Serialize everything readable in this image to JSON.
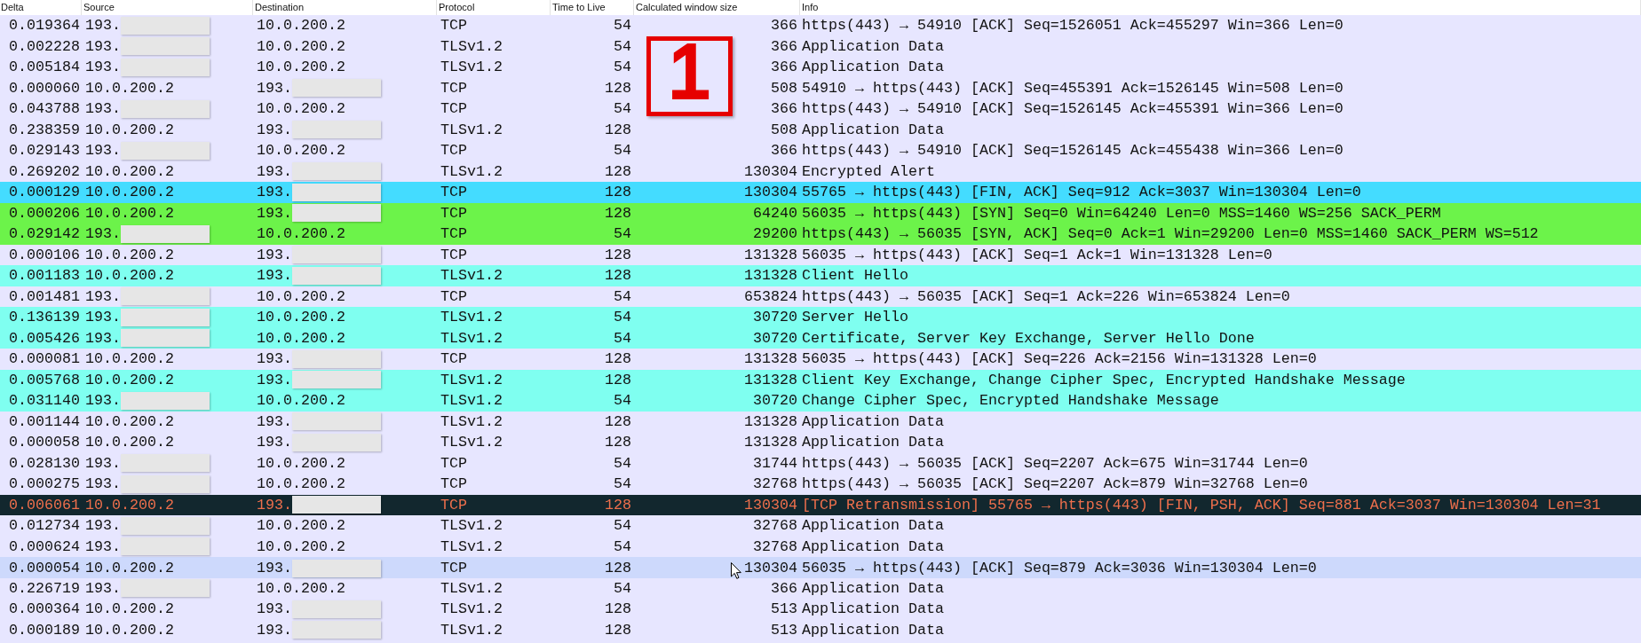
{
  "columns": [
    "Delta",
    "Source",
    "Destination",
    "Protocol",
    "Time to Live",
    "Calculated window size",
    "Info"
  ],
  "rows": [
    {
      "delta": "0.019364",
      "source": "193.",
      "source_redacted": true,
      "destination": "10.0.200.2",
      "destination_redacted": false,
      "protocol": "TCP",
      "ttl": "54",
      "window_size": "366",
      "info": "https(443) → 54910 [ACK] Seq=1526051 Ack=455297 Win=366 Len=0",
      "color": "#e7e6ff",
      "kind": "normal",
      "hovered": false
    },
    {
      "delta": "0.002228",
      "source": "193.",
      "source_redacted": true,
      "destination": "10.0.200.2",
      "destination_redacted": false,
      "protocol": "TLSv1.2",
      "ttl": "54",
      "window_size": "366",
      "info": "Application Data",
      "color": "#e7e6ff",
      "kind": "normal",
      "hovered": false
    },
    {
      "delta": "0.005184",
      "source": "193.",
      "source_redacted": true,
      "destination": "10.0.200.2",
      "destination_redacted": false,
      "protocol": "TLSv1.2",
      "ttl": "54",
      "window_size": "366",
      "info": "Application Data",
      "color": "#e7e6ff",
      "kind": "normal",
      "hovered": false
    },
    {
      "delta": "0.000060",
      "source": "10.0.200.2",
      "source_redacted": false,
      "destination": "193.",
      "destination_redacted": true,
      "protocol": "TCP",
      "ttl": "128",
      "window_size": "508",
      "info": "54910 → https(443) [ACK] Seq=455391 Ack=1526145 Win=508 Len=0",
      "color": "#e7e6ff",
      "kind": "normal",
      "hovered": false
    },
    {
      "delta": "0.043788",
      "source": "193.",
      "source_redacted": true,
      "destination": "10.0.200.2",
      "destination_redacted": false,
      "protocol": "TCP",
      "ttl": "54",
      "window_size": "366",
      "info": "https(443) → 54910 [ACK] Seq=1526145 Ack=455391 Win=366 Len=0",
      "color": "#e7e6ff",
      "kind": "normal",
      "hovered": false
    },
    {
      "delta": "0.238359",
      "source": "10.0.200.2",
      "source_redacted": false,
      "destination": "193.",
      "destination_redacted": true,
      "protocol": "TLSv1.2",
      "ttl": "128",
      "window_size": "508",
      "info": "Application Data",
      "color": "#e7e6ff",
      "kind": "normal",
      "hovered": false
    },
    {
      "delta": "0.029143",
      "source": "193.",
      "source_redacted": true,
      "destination": "10.0.200.2",
      "destination_redacted": false,
      "protocol": "TCP",
      "ttl": "54",
      "window_size": "366",
      "info": "https(443) → 54910 [ACK] Seq=1526145 Ack=455438 Win=366 Len=0",
      "color": "#e7e6ff",
      "kind": "normal",
      "hovered": false
    },
    {
      "delta": "0.269202",
      "source": "10.0.200.2",
      "source_redacted": false,
      "destination": "193.",
      "destination_redacted": true,
      "protocol": "TLSv1.2",
      "ttl": "128",
      "window_size": "130304",
      "info": "Encrypted Alert",
      "color": "#e7e6ff",
      "kind": "normal",
      "hovered": false
    },
    {
      "delta": "0.000129",
      "source": "10.0.200.2",
      "source_redacted": false,
      "destination": "193.",
      "destination_redacted": true,
      "protocol": "TCP",
      "ttl": "128",
      "window_size": "130304",
      "info": "55765 → https(443) [FIN, ACK] Seq=912 Ack=3037 Win=130304 Len=0",
      "color": "#44dcff",
      "kind": "normal",
      "hovered": false
    },
    {
      "delta": "0.000206",
      "source": "10.0.200.2",
      "source_redacted": false,
      "destination": "193.",
      "destination_redacted": true,
      "protocol": "TCP",
      "ttl": "128",
      "window_size": "64240",
      "info": "56035 → https(443) [SYN] Seq=0 Win=64240 Len=0 MSS=1460 WS=256 SACK_PERM",
      "color": "#6cf34a",
      "kind": "normal",
      "hovered": false
    },
    {
      "delta": "0.029142",
      "source": "193.",
      "source_redacted": true,
      "destination": "10.0.200.2",
      "destination_redacted": false,
      "protocol": "TCP",
      "ttl": "54",
      "window_size": "29200",
      "info": "https(443) → 56035 [SYN, ACK] Seq=0 Ack=1 Win=29200 Len=0 MSS=1460 SACK_PERM WS=512",
      "color": "#6cf34a",
      "kind": "normal",
      "hovered": false
    },
    {
      "delta": "0.000106",
      "source": "10.0.200.2",
      "source_redacted": false,
      "destination": "193.",
      "destination_redacted": true,
      "protocol": "TCP",
      "ttl": "128",
      "window_size": "131328",
      "info": "56035 → https(443) [ACK] Seq=1 Ack=1 Win=131328 Len=0",
      "color": "#e7e6ff",
      "kind": "normal",
      "hovered": false
    },
    {
      "delta": "0.001183",
      "source": "10.0.200.2",
      "source_redacted": false,
      "destination": "193.",
      "destination_redacted": true,
      "protocol": "TLSv1.2",
      "ttl": "128",
      "window_size": "131328",
      "info": "Client Hello",
      "color": "#7ffff0",
      "kind": "normal",
      "hovered": false
    },
    {
      "delta": "0.001481",
      "source": "193.",
      "source_redacted": true,
      "destination": "10.0.200.2",
      "destination_redacted": false,
      "protocol": "TCP",
      "ttl": "54",
      "window_size": "653824",
      "info": "https(443) → 56035 [ACK] Seq=1 Ack=226 Win=653824 Len=0",
      "color": "#e7e6ff",
      "kind": "normal",
      "hovered": false
    },
    {
      "delta": "0.136139",
      "source": "193.",
      "source_redacted": true,
      "destination": "10.0.200.2",
      "destination_redacted": false,
      "protocol": "TLSv1.2",
      "ttl": "54",
      "window_size": "30720",
      "info": "Server Hello",
      "color": "#7ffff0",
      "kind": "normal",
      "hovered": false
    },
    {
      "delta": "0.005426",
      "source": "193.",
      "source_redacted": true,
      "destination": "10.0.200.2",
      "destination_redacted": false,
      "protocol": "TLSv1.2",
      "ttl": "54",
      "window_size": "30720",
      "info": "Certificate, Server Key Exchange, Server Hello Done",
      "color": "#7ffff0",
      "kind": "normal",
      "hovered": false
    },
    {
      "delta": "0.000081",
      "source": "10.0.200.2",
      "source_redacted": false,
      "destination": "193.",
      "destination_redacted": true,
      "protocol": "TCP",
      "ttl": "128",
      "window_size": "131328",
      "info": "56035 → https(443) [ACK] Seq=226 Ack=2156 Win=131328 Len=0",
      "color": "#e7e6ff",
      "kind": "normal",
      "hovered": false
    },
    {
      "delta": "0.005768",
      "source": "10.0.200.2",
      "source_redacted": false,
      "destination": "193.",
      "destination_redacted": true,
      "protocol": "TLSv1.2",
      "ttl": "128",
      "window_size": "131328",
      "info": "Client Key Exchange, Change Cipher Spec, Encrypted Handshake Message",
      "color": "#7ffff0",
      "kind": "normal",
      "hovered": false
    },
    {
      "delta": "0.031140",
      "source": "193.",
      "source_redacted": true,
      "destination": "10.0.200.2",
      "destination_redacted": false,
      "protocol": "TLSv1.2",
      "ttl": "54",
      "window_size": "30720",
      "info": "Change Cipher Spec, Encrypted Handshake Message",
      "color": "#7ffff0",
      "kind": "normal",
      "hovered": false
    },
    {
      "delta": "0.001144",
      "source": "10.0.200.2",
      "source_redacted": false,
      "destination": "193.",
      "destination_redacted": true,
      "protocol": "TLSv1.2",
      "ttl": "128",
      "window_size": "131328",
      "info": "Application Data",
      "color": "#e7e6ff",
      "kind": "normal",
      "hovered": false
    },
    {
      "delta": "0.000058",
      "source": "10.0.200.2",
      "source_redacted": false,
      "destination": "193.",
      "destination_redacted": true,
      "protocol": "TLSv1.2",
      "ttl": "128",
      "window_size": "131328",
      "info": "Application Data",
      "color": "#e7e6ff",
      "kind": "normal",
      "hovered": false
    },
    {
      "delta": "0.028130",
      "source": "193.",
      "source_redacted": true,
      "destination": "10.0.200.2",
      "destination_redacted": false,
      "protocol": "TCP",
      "ttl": "54",
      "window_size": "31744",
      "info": "https(443) → 56035 [ACK] Seq=2207 Ack=675 Win=31744 Len=0",
      "color": "#e7e6ff",
      "kind": "normal",
      "hovered": false
    },
    {
      "delta": "0.000275",
      "source": "193.",
      "source_redacted": true,
      "destination": "10.0.200.2",
      "destination_redacted": false,
      "protocol": "TCP",
      "ttl": "54",
      "window_size": "32768",
      "info": "https(443) → 56035 [ACK] Seq=2207 Ack=879 Win=32768 Len=0",
      "color": "#e7e6ff",
      "kind": "normal",
      "hovered": false
    },
    {
      "delta": "0.006061",
      "source": "10.0.200.2",
      "source_redacted": false,
      "destination": "193.",
      "destination_redacted": true,
      "protocol": "TCP",
      "ttl": "128",
      "window_size": "130304",
      "info": "[TCP Retransmission] 55765 → https(443) [FIN, PSH, ACK] Seq=881 Ack=3037 Win=130304 Len=31",
      "color": "#12272e",
      "kind": "error",
      "hovered": false
    },
    {
      "delta": "0.012734",
      "source": "193.",
      "source_redacted": true,
      "destination": "10.0.200.2",
      "destination_redacted": false,
      "protocol": "TLSv1.2",
      "ttl": "54",
      "window_size": "32768",
      "info": "Application Data",
      "color": "#e7e6ff",
      "kind": "normal",
      "hovered": false
    },
    {
      "delta": "0.000624",
      "source": "193.",
      "source_redacted": true,
      "destination": "10.0.200.2",
      "destination_redacted": false,
      "protocol": "TLSv1.2",
      "ttl": "54",
      "window_size": "32768",
      "info": "Application Data",
      "color": "#e7e6ff",
      "kind": "normal",
      "hovered": false
    },
    {
      "delta": "0.000054",
      "source": "10.0.200.2",
      "source_redacted": false,
      "destination": "193.",
      "destination_redacted": true,
      "protocol": "TCP",
      "ttl": "128",
      "window_size": "130304",
      "info": "56035 → https(443) [ACK] Seq=879 Ack=3036 Win=130304 Len=0",
      "color": "#cdd9fc",
      "kind": "normal",
      "hovered": true
    },
    {
      "delta": "0.226719",
      "source": "193.",
      "source_redacted": true,
      "destination": "10.0.200.2",
      "destination_redacted": false,
      "protocol": "TLSv1.2",
      "ttl": "54",
      "window_size": "366",
      "info": "Application Data",
      "color": "#e7e6ff",
      "kind": "normal",
      "hovered": false
    },
    {
      "delta": "0.000364",
      "source": "10.0.200.2",
      "source_redacted": false,
      "destination": "193.",
      "destination_redacted": true,
      "protocol": "TLSv1.2",
      "ttl": "128",
      "window_size": "513",
      "info": "Application Data",
      "color": "#e7e6ff",
      "kind": "normal",
      "hovered": false
    },
    {
      "delta": "0.000189",
      "source": "10.0.200.2",
      "source_redacted": false,
      "destination": "193.",
      "destination_redacted": true,
      "protocol": "TLSv1.2",
      "ttl": "128",
      "window_size": "513",
      "info": "Application Data",
      "color": "#e7e6ff",
      "kind": "normal",
      "hovered": false
    }
  ],
  "annotation": {
    "label": "1"
  }
}
